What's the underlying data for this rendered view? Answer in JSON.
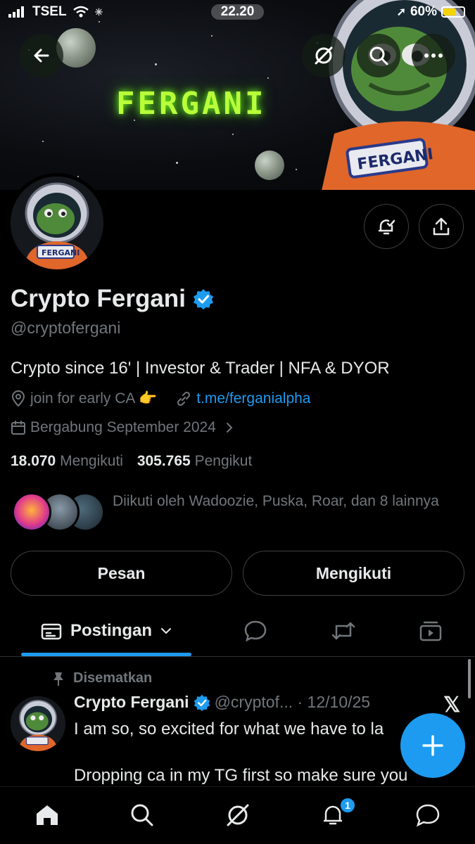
{
  "status_bar": {
    "carrier": "TSEL",
    "time": "22.20",
    "battery": "60%"
  },
  "banner": {
    "title": "FERGANI",
    "suit_label": "FERGANI"
  },
  "profile": {
    "name": "Crypto Fergani",
    "handle": "@cryptofergani",
    "bio": "Crypto since 16' | Investor & Trader | NFA & DYOR",
    "location": "join for early CA 👉",
    "link": "t.me/ferganialpha",
    "joined": "Bergabung September 2024",
    "following_count": "18.070",
    "following_label": "Mengikuti",
    "followers_count": "305.765",
    "followers_label": "Pengikut",
    "followed_by": "Diikuti oleh Wadoozie, Puska, Roar, dan 8 lainnya",
    "avatar_label": "FERGANI"
  },
  "actions": {
    "message": "Pesan",
    "following": "Mengikuti"
  },
  "tabs": {
    "active": "Postingan"
  },
  "post": {
    "pinned_label": "Disematkan",
    "author": "Crypto Fergani",
    "handle_date": "@cryptof... · 12/10/25",
    "line1": "I am so, so excited for what we have to la",
    "line2": "",
    "line3": "Dropping ca in my TG first so make sure you"
  },
  "notifications": {
    "badge": "1"
  },
  "colors": {
    "accent": "#1d9bf0",
    "verified": "#1d9bf0",
    "banner_glow": "#b9ff3a"
  }
}
